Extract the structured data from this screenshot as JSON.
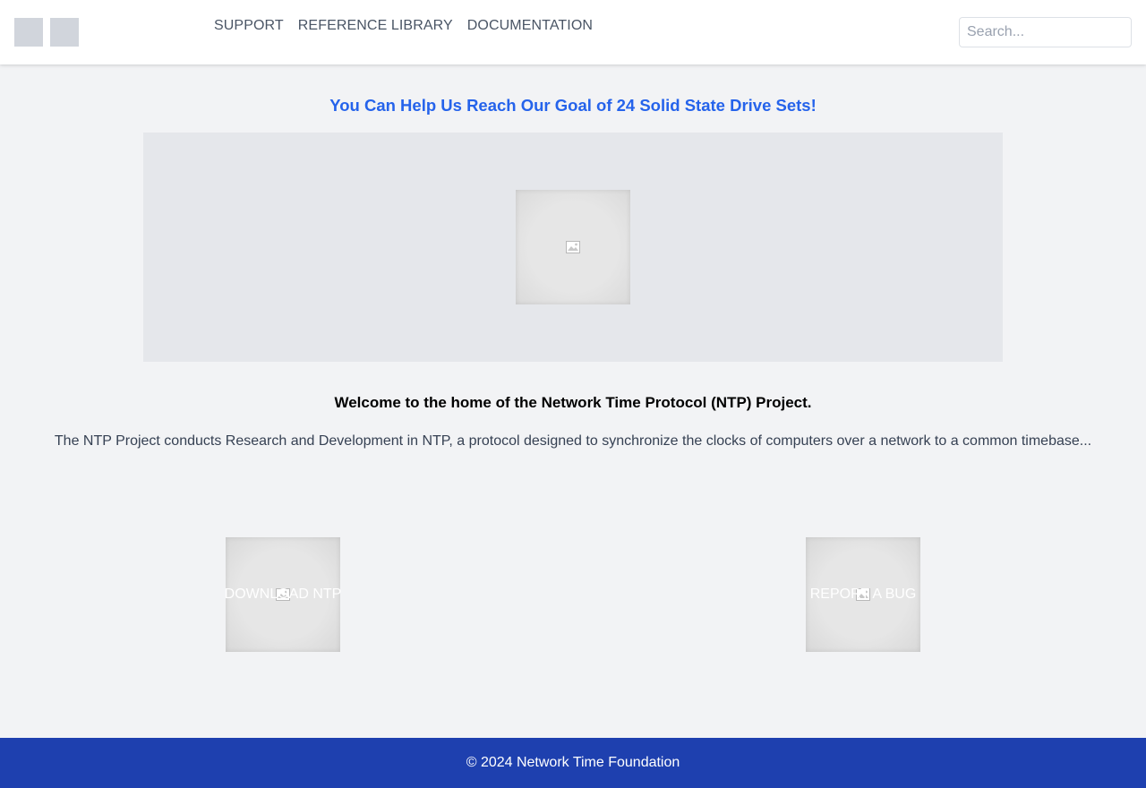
{
  "header": {
    "logos": [
      "logo-placeholder",
      "logo-placeholder"
    ],
    "nav": [
      {
        "label": "SUPPORT"
      },
      {
        "label": "REFERENCE LIBRARY"
      },
      {
        "label": "DOCUMENTATION"
      }
    ],
    "search": {
      "placeholder": "Search...",
      "value": ""
    }
  },
  "banner": {
    "title": "You Can Help Us Reach Our Goal of 24 Solid State Drive Sets!",
    "image_icon": "broken-image-icon"
  },
  "main": {
    "welcome": "Welcome to the home of the Network Time Protocol (NTP) Project.",
    "intro": "The NTP Project conducts Research and Development in NTP, a protocol designed to synchronize the clocks of computers over a network to a common timebase..."
  },
  "actions": [
    {
      "label": "DOWNLOAD NTP",
      "icon": "broken-image-icon"
    },
    {
      "label": "REPORT A BUG",
      "icon": "broken-image-icon"
    }
  ],
  "footer": {
    "text": "© 2024 Network Time Foundation"
  },
  "colors": {
    "accent": "#2563eb",
    "footer_bg": "#1e40af",
    "page_bg": "#f2f3f5",
    "banner_bg": "#e5e7eb"
  }
}
